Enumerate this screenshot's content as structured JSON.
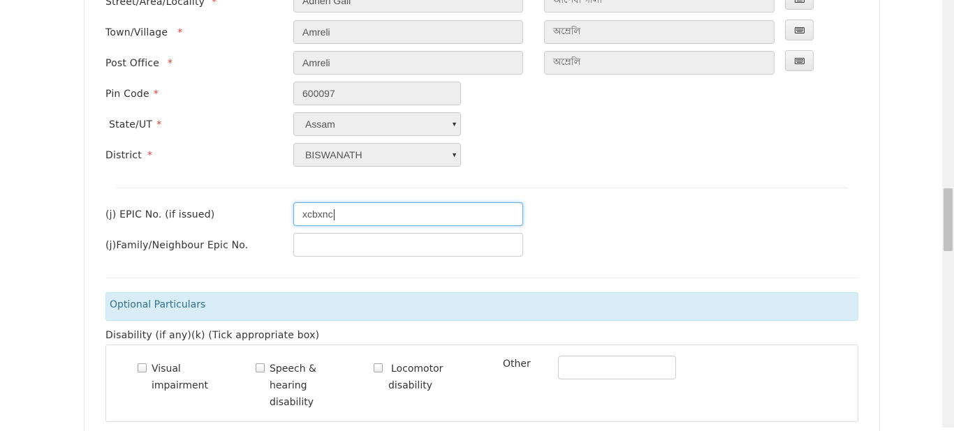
{
  "address": {
    "street": {
      "label": "Street/Area/Locality",
      "value_en": "Adhen Gali",
      "value_local": "আপেধা গালী"
    },
    "town": {
      "label": "Town/Village",
      "value_en": "Amreli",
      "value_local": "অম্রেলি"
    },
    "post_office": {
      "label": "Post Office",
      "value_en": "Amreli",
      "value_local": "অম্রেলি"
    },
    "pin_code": {
      "label": "Pin Code",
      "value": "600097"
    },
    "state": {
      "label": "State/UT",
      "selected": "Assam"
    },
    "district": {
      "label": "District",
      "selected": "BISWANATH"
    },
    "required_mark": "*"
  },
  "epic": {
    "label": "(j) EPIC No. (if issued)",
    "value": "xcbxnc"
  },
  "family_epic": {
    "label": "(j)Family/Neighbour Epic No.",
    "value": ""
  },
  "optional": {
    "heading": "Optional Particulars",
    "disability_label": "Disability (if any)(k) (Tick appropriate box)",
    "options": [
      {
        "line1": "Visual",
        "line2": "impairment",
        "line3": "",
        "checked": false
      },
      {
        "line1": "Speech &",
        "line2": "hearing",
        "line3": "disability",
        "checked": false
      },
      {
        "line1": "Locomotor",
        "line2": "disability",
        "line3": "",
        "checked": false
      }
    ],
    "other_label": "Other",
    "other_value": ""
  },
  "icons": {
    "keyboard": "keyboard-icon",
    "dropdown": "dropdown-arrow-icon"
  },
  "colors": {
    "required": "#e23b3b",
    "info_bg": "#d9edf7",
    "info_text": "#31708f",
    "focus_border": "#66afe9",
    "readonly_bg": "#eeeeee"
  }
}
